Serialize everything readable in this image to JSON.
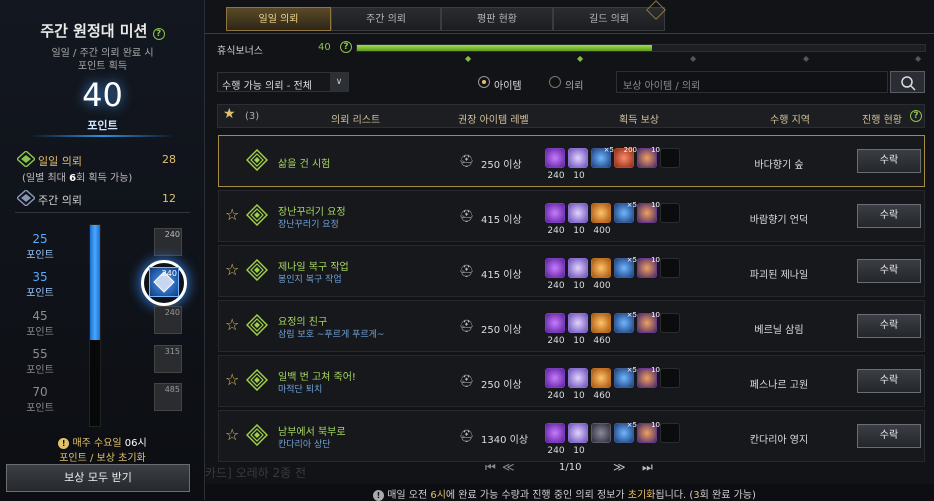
{
  "left": {
    "title": "주간 원정대 미션",
    "desc_line1": "일일 / 주간 의뢰 완료 시",
    "desc_line2": "포인트 획득",
    "points_value": "40",
    "points_label": "포인트",
    "daily_label": "일일 의뢰",
    "daily_value": "28",
    "daily_note_prefix": "(일별 최대 ",
    "daily_note_num": "6",
    "daily_note_suffix": "회 획득 가능)",
    "weekly_label": "주간 의뢰",
    "weekly_value": "12",
    "progress_fraction": 0.57,
    "milestones": [
      {
        "value": "25",
        "label": "포인트",
        "badge": "240"
      },
      {
        "value": "35",
        "label": "포인트",
        "badge": "240"
      },
      {
        "value": "45",
        "label": "포인트",
        "badge": "240"
      },
      {
        "value": "55",
        "label": "포인트",
        "badge": "315"
      },
      {
        "value": "70",
        "label": "포인트",
        "badge": "485"
      }
    ],
    "reset_line1_prefix": "매주 수요일 ",
    "reset_line1_time": "06시",
    "reset_line2": "포인트 / 보상 초기화",
    "claim_all": "보상 모두 받기"
  },
  "tabs": [
    "일일 의뢰",
    "주간 의뢰",
    "평판 현황",
    "길드 의뢰"
  ],
  "rest_bonus": {
    "label": "휴식보너스",
    "value": "40",
    "fraction": 0.52
  },
  "filter": {
    "select_value": "수행 가능 의뢰 - 전체",
    "radio_item": "아이템",
    "radio_quest": "의뢰",
    "search_placeholder": "보상 아이템 / 의뢰"
  },
  "table_header": {
    "star_count": "(3)",
    "quest_list": "의뢰 리스트",
    "item_level": "권장 아이템 레벨",
    "rewards": "획득 보상",
    "region": "수행 지역",
    "progress": "진행 현황"
  },
  "quests": [
    {
      "title": "삶을 건 시험",
      "subtitle": "",
      "level": "250 이상",
      "region": "바다향기 숲",
      "button": "수락",
      "starred": false,
      "selected": true,
      "rewards": [
        {
          "kind": "purple",
          "count": "240"
        },
        {
          "kind": "crystal",
          "count": "10"
        },
        {
          "kind": "blue",
          "count": "",
          "sup": "×5"
        },
        {
          "kind": "orn",
          "count": "",
          "sup": "200"
        },
        {
          "kind": "feather",
          "count": "",
          "sup": "10"
        },
        {
          "kind": "empty",
          "count": ""
        }
      ]
    },
    {
      "title": "장난꾸러기 요정",
      "subtitle": "장난꾸러기 요정",
      "level": "415 이상",
      "region": "바람향기 언덕",
      "button": "수락",
      "starred": true,
      "selected": false,
      "rewards": [
        {
          "kind": "purple",
          "count": "240"
        },
        {
          "kind": "crystal",
          "count": "10"
        },
        {
          "kind": "amber",
          "count": "400"
        },
        {
          "kind": "blue",
          "count": "",
          "sup": "×5"
        },
        {
          "kind": "feather",
          "count": "",
          "sup": "10"
        },
        {
          "kind": "empty",
          "count": ""
        }
      ]
    },
    {
      "title": "제나일 복구 작업",
      "subtitle": "봉인지 복구 작업",
      "level": "415 이상",
      "region": "파괴된 제나일",
      "button": "수락",
      "starred": true,
      "selected": false,
      "rewards": [
        {
          "kind": "purple",
          "count": "240"
        },
        {
          "kind": "crystal",
          "count": "10"
        },
        {
          "kind": "amber",
          "count": "400"
        },
        {
          "kind": "blue",
          "count": "",
          "sup": "×5"
        },
        {
          "kind": "feather",
          "count": "",
          "sup": "10"
        },
        {
          "kind": "empty",
          "count": ""
        }
      ]
    },
    {
      "title": "요정의 친구",
      "subtitle": "삼림 보호 ~푸르게 푸르게~",
      "level": "250 이상",
      "region": "베르닐 삼림",
      "button": "수락",
      "starred": true,
      "selected": false,
      "rewards": [
        {
          "kind": "purple",
          "count": "240"
        },
        {
          "kind": "crystal",
          "count": "10"
        },
        {
          "kind": "amber",
          "count": "460"
        },
        {
          "kind": "blue",
          "count": "",
          "sup": "×5"
        },
        {
          "kind": "feather",
          "count": "",
          "sup": "10"
        },
        {
          "kind": "empty",
          "count": ""
        }
      ]
    },
    {
      "title": "일백 번 고쳐 죽어!",
      "subtitle": "마적단 퇴치",
      "level": "250 이상",
      "region": "페스나르 고원",
      "button": "수락",
      "starred": true,
      "selected": false,
      "rewards": [
        {
          "kind": "purple",
          "count": "240"
        },
        {
          "kind": "crystal",
          "count": "10"
        },
        {
          "kind": "amber",
          "count": "460"
        },
        {
          "kind": "blue",
          "count": "",
          "sup": "×5"
        },
        {
          "kind": "feather",
          "count": "",
          "sup": "10"
        },
        {
          "kind": "empty",
          "count": ""
        }
      ]
    },
    {
      "title": "남부에서 북부로",
      "subtitle": "칸다리아 상단",
      "level": "1340 이상",
      "region": "칸다리아 영지",
      "button": "수락",
      "starred": true,
      "selected": false,
      "rewards": [
        {
          "kind": "purple",
          "count": "240"
        },
        {
          "kind": "crystal",
          "count": "10"
        },
        {
          "kind": "gun",
          "count": ""
        },
        {
          "kind": "blue",
          "count": "",
          "sup": "×5"
        },
        {
          "kind": "feather",
          "count": "",
          "sup": "10"
        },
        {
          "kind": "empty",
          "count": ""
        }
      ]
    }
  ],
  "pagination": {
    "page": "1/10"
  },
  "footer": {
    "prefix": "매일 오전 ",
    "time": "6시",
    "mid": "에 완료 가능 수량과 진행 중인 의뢰 정보가 ",
    "reset": "초기화",
    "suffix": "됩니다. (",
    "count": "3",
    "end": "회 완료 가능)"
  },
  "background_text": "카드] 오레하 2종 전",
  "colors": {
    "green": "#8bc34a",
    "gold": "#e3c06a",
    "blue": "#2d8fe8"
  }
}
